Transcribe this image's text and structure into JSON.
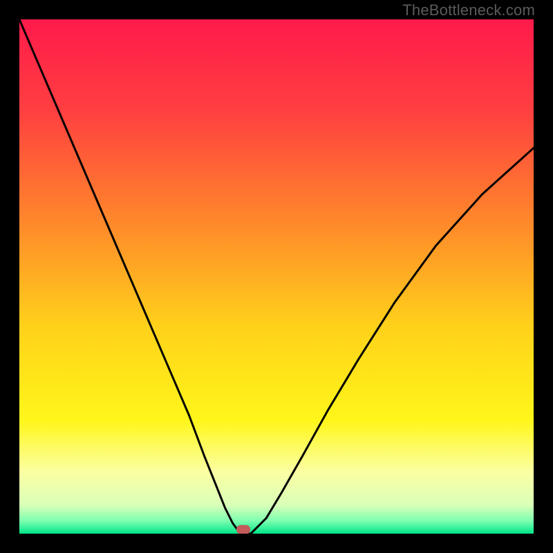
{
  "watermark": "TheBottleneck.com",
  "chart_data": {
    "type": "line",
    "title": "",
    "xlabel": "",
    "ylabel": "",
    "xlim": [
      0,
      100
    ],
    "ylim": [
      0,
      100
    ],
    "background_gradient_stops": [
      {
        "pos": 0,
        "color": "#ff1a4b"
      },
      {
        "pos": 0.18,
        "color": "#ff4040"
      },
      {
        "pos": 0.4,
        "color": "#ff8a2a"
      },
      {
        "pos": 0.6,
        "color": "#ffd21a"
      },
      {
        "pos": 0.78,
        "color": "#fff61a"
      },
      {
        "pos": 0.88,
        "color": "#fbffa3"
      },
      {
        "pos": 0.945,
        "color": "#d9ffb8"
      },
      {
        "pos": 0.975,
        "color": "#7dffb0"
      },
      {
        "pos": 1.0,
        "color": "#00e589"
      }
    ],
    "series": [
      {
        "name": "bottleneck-curve",
        "color": "#000000",
        "x": [
          0,
          3,
          6,
          9,
          12,
          15,
          18,
          21,
          24,
          27,
          30,
          33,
          36,
          38,
          40,
          41.5,
          43,
          44,
          45,
          48,
          51,
          55,
          60,
          66,
          73,
          81,
          90,
          100
        ],
        "y": [
          100,
          93,
          86,
          79,
          72,
          65,
          58,
          51,
          44,
          37,
          30,
          23,
          15,
          10,
          5,
          2,
          0,
          0,
          0,
          3,
          8,
          15,
          24,
          34,
          45,
          56,
          66,
          75
        ]
      }
    ],
    "marker": {
      "x": 43.5,
      "y": 0.8,
      "color": "#c45a5a",
      "name": "optimum-marker"
    }
  }
}
